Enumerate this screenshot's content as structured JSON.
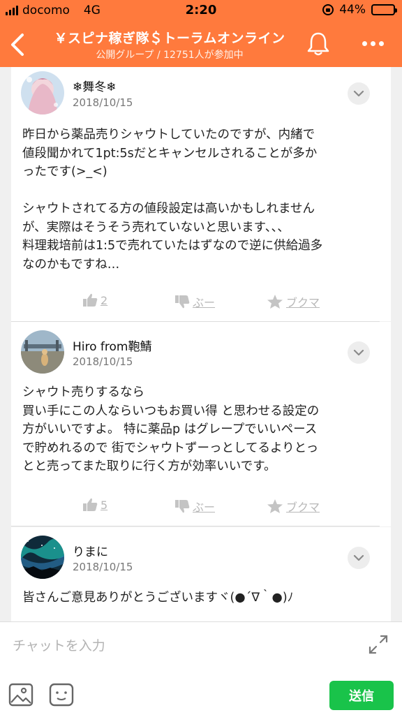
{
  "status_bar": {
    "carrier": "docomo",
    "network": "4G",
    "time": "2:20",
    "battery": "44%",
    "battery_level": 0.44
  },
  "header": {
    "title": "￥スピナ稼ぎ隊＄トーラムオンライン",
    "subtitle": "公開グループ / 12751人が参加中",
    "back_icon": "back-arrow-icon",
    "bell_icon": "bell-icon",
    "more_icon": "more-dots-icon"
  },
  "posts": [
    {
      "user": "❄舞冬❄",
      "date": "2018/10/15",
      "text": "昨日から薬品売りシャウトしていたのですが、内緒で\n値段聞かれて1pt:5sだとキャンセルされることが多か\nったです(>_<)\n\nシャウトされてる方の値段設定は高いかもしれません\nが、実際はそうそう売れていないと思います、、、\n料理栽培前は1:5で売れていたはずなので逆に供給過多\nなのかもですね…",
      "like_count": "2",
      "boo_label": "ぶー",
      "bookmark_label": "ブクマ"
    },
    {
      "user": "Hiro from鞄鯖",
      "date": "2018/10/15",
      "text": "シャウト売りするなら\n買い手にこの人ならいつもお買い得 と思わせる設定の\n方がいいですよ。 特に薬品p はグレープでいいペース\nで貯めれるので 街でシャウトずーっとしてるよりとっ\nとと売ってまた取りに行く方が効率いいです。",
      "like_count": "5",
      "boo_label": "ぶー",
      "bookmark_label": "ブクマ"
    },
    {
      "user": "りまに",
      "date": "2018/10/15",
      "text": "皆さんご意見ありがとうございますヾ(●´∇｀●)ﾉ"
    }
  ],
  "composer": {
    "placeholder": "チャットを入力",
    "send_label": "送信"
  },
  "colors": {
    "brand": "#ff7a3d",
    "send": "#19c34a"
  }
}
